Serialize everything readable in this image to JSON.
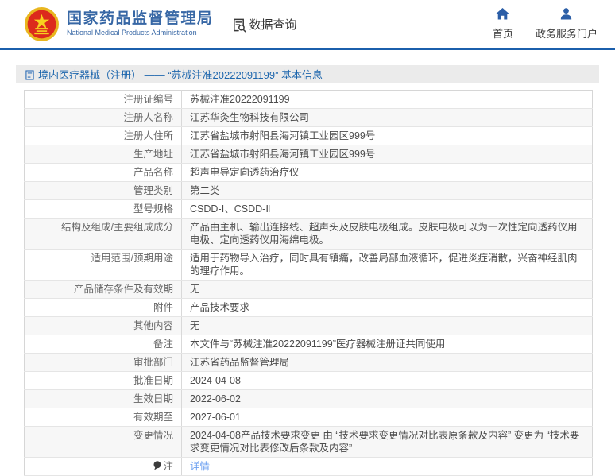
{
  "header": {
    "site_name": "国家药品监督管理局",
    "site_name_en": "National Medical Products Administration",
    "nav_data_query": "数据查询",
    "nav_home": "首页",
    "nav_portal": "政务服务门户"
  },
  "page": {
    "title": "境内医疗器械（注册） —— “苏械注准20222091199” 基本信息"
  },
  "colors": {
    "brand_blue": "#3767a5",
    "divider_blue": "#1b5fac",
    "title_text_blue": "#1d66ad",
    "title_bar_bg": "#ebebeb",
    "link_blue": "#6b9ff0",
    "emblem_red": "#dc2a1c",
    "emblem_gold": "#f7d21e"
  },
  "table": {
    "rows": [
      {
        "label": "注册证编号",
        "value": "苏械注准20222091199"
      },
      {
        "label": "注册人名称",
        "value": "江苏华灸生物科技有限公司"
      },
      {
        "label": "注册人住所",
        "value": "江苏省盐城市射阳县海河镇工业园区999号"
      },
      {
        "label": "生产地址",
        "value": "江苏省盐城市射阳县海河镇工业园区999号"
      },
      {
        "label": "产品名称",
        "value": "超声电导定向透药治疗仪"
      },
      {
        "label": "管理类别",
        "value": "第二类"
      },
      {
        "label": "型号规格",
        "value": "CSDD-Ⅰ、CSDD-Ⅱ"
      },
      {
        "label": "结构及组成/主要组成成分",
        "value": "产品由主机、输出连接线、超声头及皮肤电极组成。皮肤电极可以为一次性定向透药仪用电极、定向透药仪用海绵电极。"
      },
      {
        "label": "适用范围/预期用途",
        "value": "适用于药物导入治疗，同时具有镇痛，改善局部血液循环，促进炎症消散，兴奋神经肌肉的理疗作用。"
      },
      {
        "label": "产品储存条件及有效期",
        "value": "无"
      },
      {
        "label": "附件",
        "value": "产品技术要求"
      },
      {
        "label": "其他内容",
        "value": "无"
      },
      {
        "label": "备注",
        "value": "本文件与“苏械注准20222091199”医疗器械注册证共同使用"
      },
      {
        "label": "审批部门",
        "value": "江苏省药品监督管理局"
      },
      {
        "label": "批准日期",
        "value": "2024-04-08"
      },
      {
        "label": "生效日期",
        "value": "2022-06-02"
      },
      {
        "label": "有效期至",
        "value": "2027-06-01"
      },
      {
        "label": "变更情况",
        "value": "2024-04-08产品技术要求变更 由 “技术要求变更情况对比表原条款及内容” 变更为 “技术要求变更情况对比表修改后条款及内容”"
      },
      {
        "label": "注",
        "value": "详情",
        "note_icon": true,
        "link": true
      }
    ]
  }
}
